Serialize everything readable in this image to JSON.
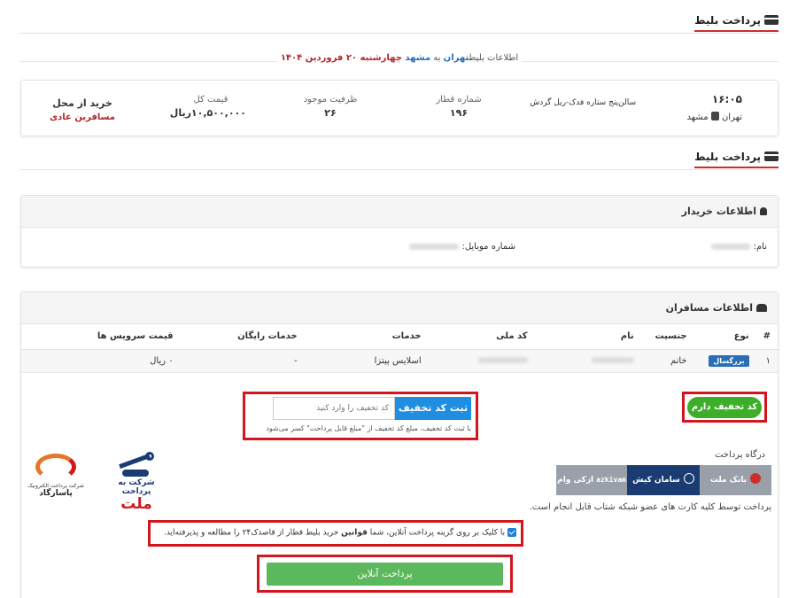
{
  "section1": {
    "title": "پرداخت بلیط"
  },
  "route": {
    "prefix": "اطلاعات بلیط",
    "origin": "تهران",
    "middle": " به ",
    "destination": "مشهد",
    "date": " چهارشنبه ۲۰ فروردین ۱۴۰۴"
  },
  "ticket": {
    "time": "۱۶:۰۵",
    "route": "تهران",
    "route_dest": "مشهد",
    "train_name": "سالن‌پنج ستاره فدک-ریل گردش",
    "train_number_label": "شماره قطار",
    "train_number": "۱۹۶",
    "capacity_label": "ظرفیت موجود",
    "capacity": "۲۶",
    "price_label": "قیمت کل",
    "price": "۱۰,۵۰۰,۰۰۰ریال",
    "purchase_label": "خرید از محل",
    "purchase_value": "مسافرین عادی"
  },
  "section2": {
    "title": "پرداخت بلیط"
  },
  "buyer": {
    "title": "اطلاعات خریدار",
    "name_label": "نام:",
    "mobile_label": "شماره موبایل:"
  },
  "passengers": {
    "title": "اطلاعات مسافران",
    "columns": [
      "#",
      "نوع",
      "جنسیت",
      "نام",
      "کد ملی",
      "خدمات",
      "خدمات رایگان",
      "قیمت سرویس ها"
    ],
    "rows": [
      {
        "index": "۱",
        "type": "بزرگسال",
        "gender": "خانم",
        "services": "اسلایس پیتزا",
        "free_services": "-",
        "service_price": "۰ ریال"
      }
    ]
  },
  "discount": {
    "have_code_label": "کد تخفیف دارم",
    "submit_label": "ثبت کد تخفیف",
    "placeholder": "کد تخفیف را وارد کنید",
    "note": "با ثبت کد تخفیف، مبلغ کد تخفیف از \"مبلغ قابل پرداخت\" کسر می‌شود"
  },
  "gateway": {
    "title": "درگاه پرداخت",
    "options": [
      "بانک ملت",
      "سامان کیش",
      "ازکی وام"
    ],
    "azki_latin": "azkivam",
    "note": "پرداخت توسط کلیه کارت های عضو شبکه شتاب قابل انجام است.",
    "mellat_logo_line1": "شرکت به پرداخت",
    "mellat_logo_line2": "ملت",
    "pasargad_line1": "شرکت پرداخت الکترونیک",
    "pasargad_line2": "پاسارگاد"
  },
  "terms": {
    "text_before": "با کلیک بر روی گزینه پرداخت آنلاین، شما ",
    "bold": "قوانین",
    "text_after": " خرید بلیط قطار از قاصدک۲۴ را مطالعه و پذیرفته‌اید."
  },
  "pay": {
    "label": "پرداخت آنلاین"
  }
}
